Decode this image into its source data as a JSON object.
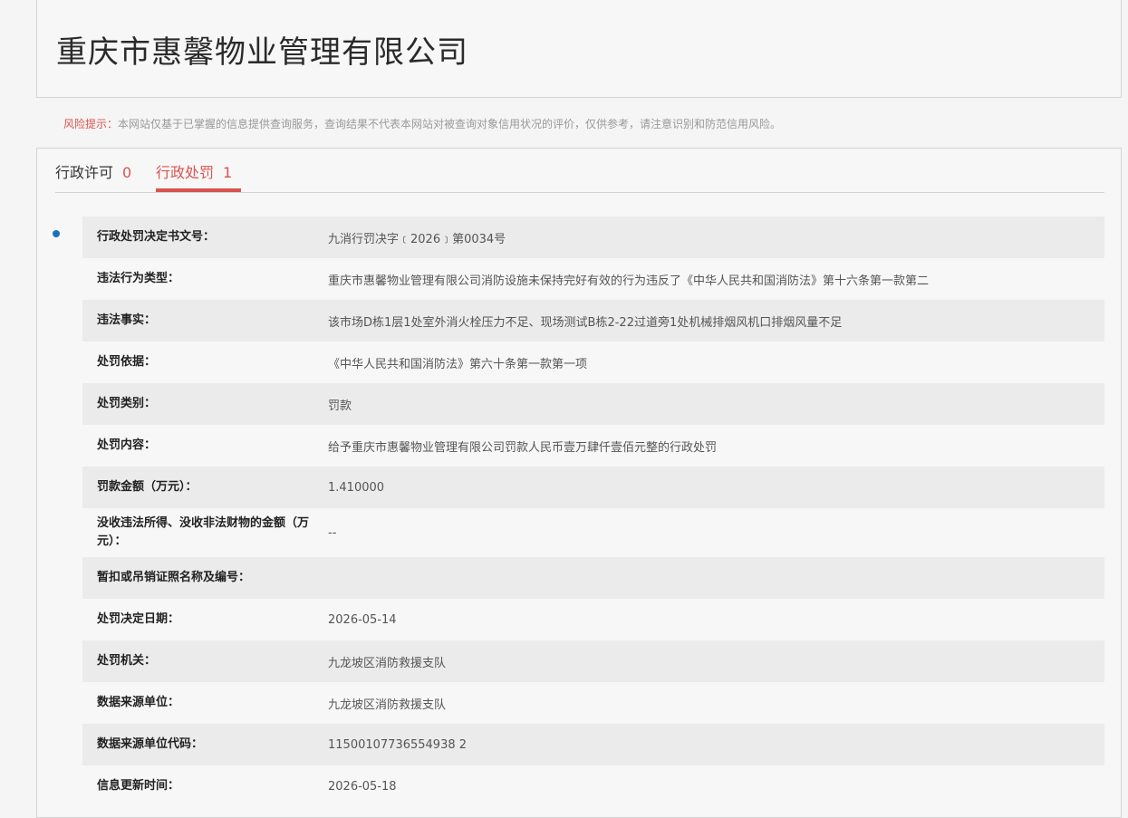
{
  "header": {
    "company_name": "重庆市惠馨物业管理有限公司"
  },
  "risk_notice": {
    "label": "风险提示：",
    "text": "本网站仅基于已掌握的信息提供查询服务，查询结果不代表本网站对被查询对象信用状况的评价，仅供参考，请注意识别和防范信用风险。"
  },
  "tabs": [
    {
      "label": "行政许可",
      "count": "0",
      "active": false
    },
    {
      "label": "行政处罚",
      "count": "1",
      "active": true
    }
  ],
  "details": [
    {
      "label": "行政处罚决定书文号：",
      "value": "九消行罚决字﹝2026﹞第0034号"
    },
    {
      "label": "违法行为类型：",
      "value": "重庆市惠馨物业管理有限公司消防设施未保持完好有效的行为违反了《中华人民共和国消防法》第十六条第一款第二"
    },
    {
      "label": "违法事实：",
      "value": "该市场D栋1层1处室外消火栓压力不足、现场测试B栋2-22过道旁1处机械排烟风机口排烟风量不足"
    },
    {
      "label": "处罚依据：",
      "value": "《中华人民共和国消防法》第六十条第一款第一项"
    },
    {
      "label": "处罚类别：",
      "value": "罚款"
    },
    {
      "label": "处罚内容：",
      "value": "给予重庆市惠馨物业管理有限公司罚款人民币壹万肆仟壹佰元整的行政处罚"
    },
    {
      "label": "罚款金额（万元）：",
      "value": "1.410000"
    },
    {
      "label": "没收违法所得、没收非法财物的金额（万元）：",
      "value": "--"
    },
    {
      "label": "暂扣或吊销证照名称及编号：",
      "value": ""
    },
    {
      "label": "处罚决定日期：",
      "value": "2026-05-14"
    },
    {
      "label": "处罚机关：",
      "value": "九龙坡区消防救援支队"
    },
    {
      "label": "数据来源单位：",
      "value": "九龙坡区消防救援支队"
    },
    {
      "label": "数据来源单位代码：",
      "value": "11500107736554938 2"
    },
    {
      "label": "信息更新时间：",
      "value": "2026-05-18"
    }
  ],
  "colors": {
    "accent": "#d9534f",
    "bullet": "#1e6fbf"
  }
}
